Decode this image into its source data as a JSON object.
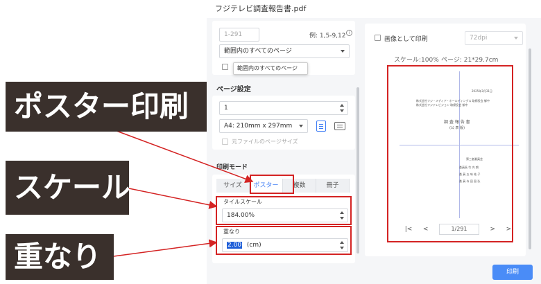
{
  "window": {
    "title": "フジテレビ調査報告書.pdf"
  },
  "range": {
    "pages_value": "1-291",
    "example_hint": "例: 1,5-9,12",
    "subset_select": "範囲内のすべてのページ",
    "tooltip": "範囲内のすべてのページ"
  },
  "page_setup": {
    "title": "ページ設定",
    "copies": "1",
    "paper_size": "A4: 210mm x 297mm",
    "original_size_label": "元ファイルのページサイズ"
  },
  "print_mode": {
    "title": "印刷モード",
    "tabs": [
      "サイズ",
      "ポスター",
      "複数",
      "冊子"
    ],
    "active_tab": "ポスター",
    "tile_scale_label": "タイルスケール",
    "tile_scale_value": "184.00%",
    "overlap_label": "重なり",
    "overlap_value": "2.00",
    "overlap_unit": "(cm)"
  },
  "preview": {
    "as_image_label": "画像として印刷",
    "dpi": "72dpi",
    "scale_info": "スケール:100%",
    "page_info": "ページ: 21*29.7cm",
    "page_indicator": "1/291",
    "doc_date": "2025年3月31日",
    "doc_line1": "株式会社フジ・メディア・ホールディングス 取締役会 御中",
    "doc_line2": "株式会社フジテレビジョン 取締役会 御中",
    "doc_title_main": "調 査 報 告 書",
    "doc_title_sub": "(公 表 版)",
    "doc_committee": "第三者委員会",
    "doc_members": [
      "委員長 竹 内 朗",
      "委 員 五 味 祐 子",
      "委 員 寺 田 昌 弘"
    ]
  },
  "actions": {
    "print_label": "印刷"
  },
  "annotations": {
    "poster": "ポスター印刷",
    "scale": "スケール",
    "overlap": "重なり"
  },
  "colors": {
    "accent": "#3d7cf5",
    "annotation_bg": "#3a302c",
    "highlight": "#d42323",
    "print_button": "#4a8cf7"
  }
}
